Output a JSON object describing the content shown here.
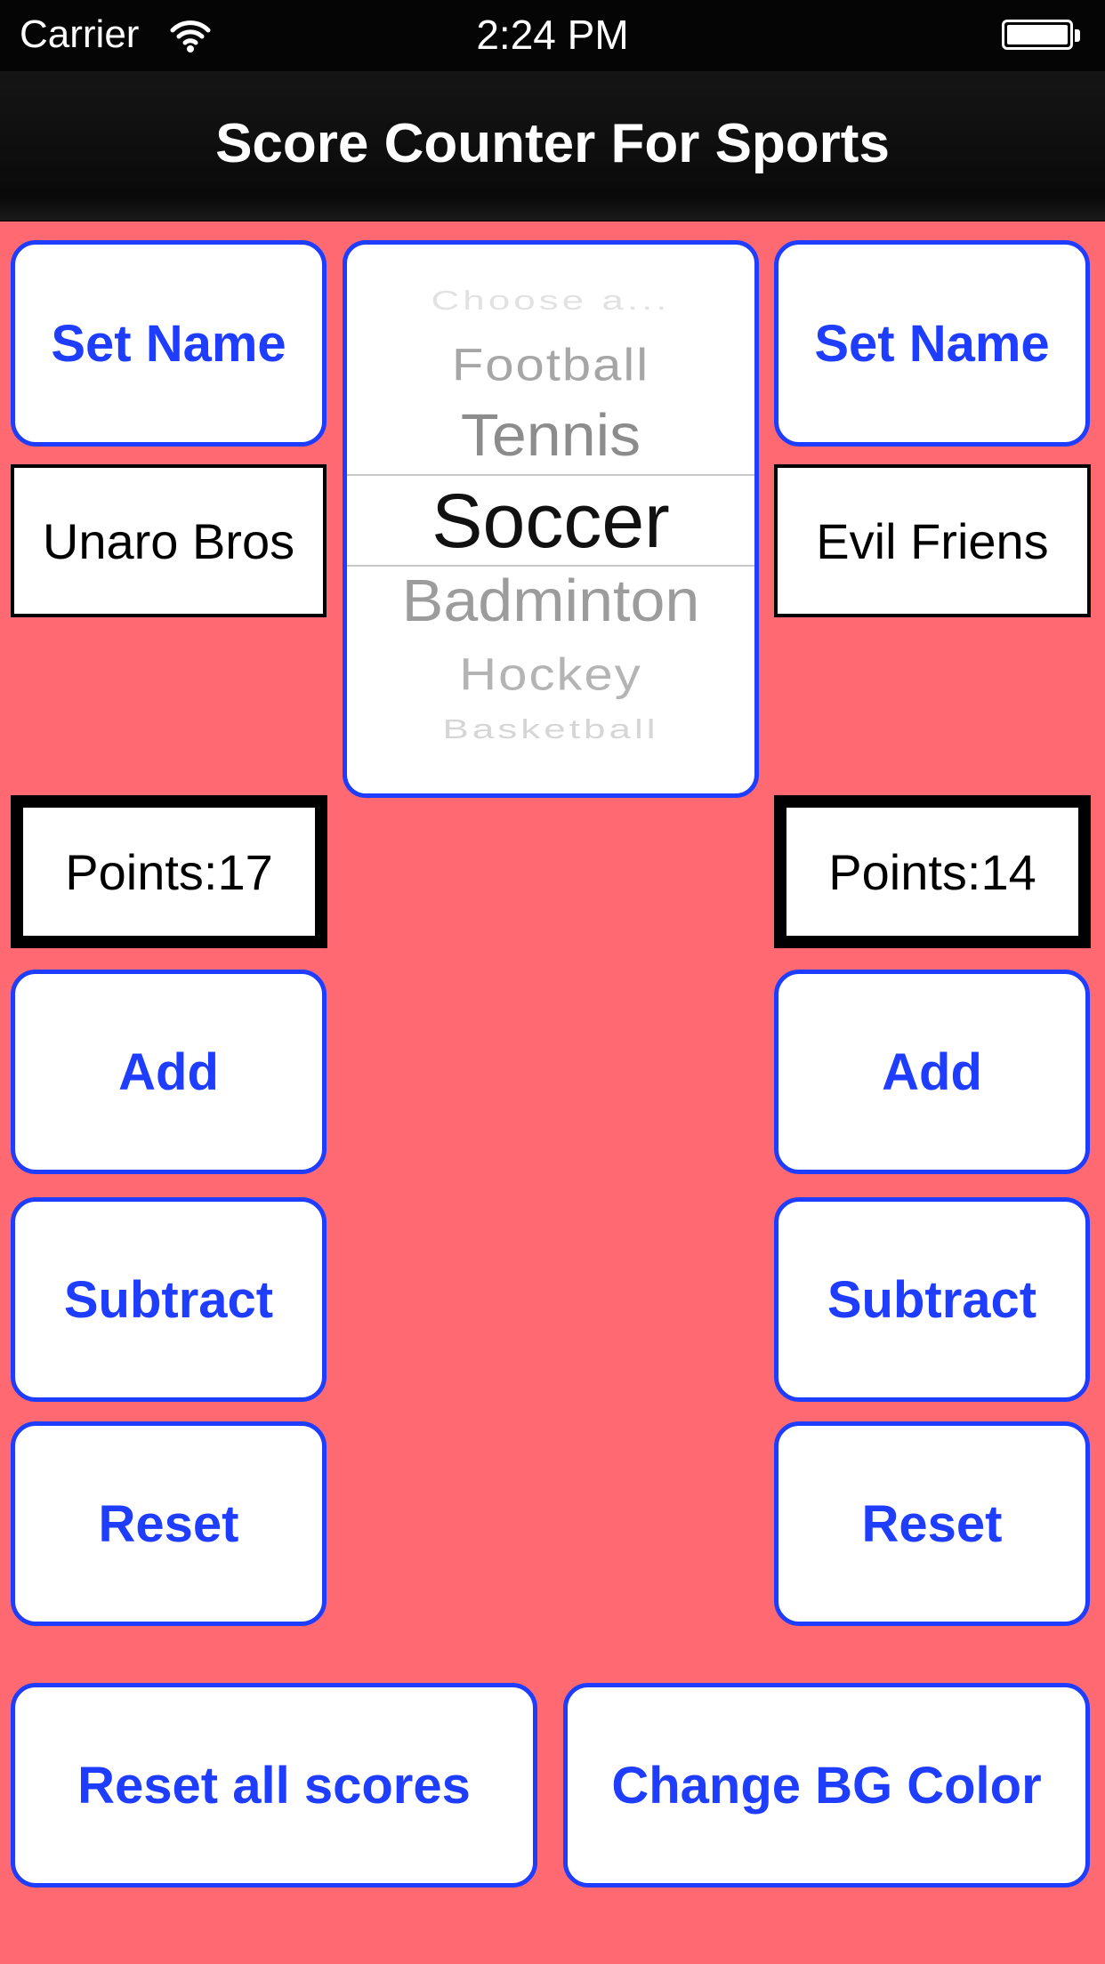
{
  "status_bar": {
    "carrier": "Carrier",
    "time": "2:24 PM"
  },
  "nav": {
    "title": "Score Counter For Sports"
  },
  "picker": {
    "items": [
      "Choose a...",
      "Football",
      "Tennis",
      "Soccer",
      "Badminton",
      "Hockey",
      "Basketball"
    ],
    "selected": "Soccer"
  },
  "team_left": {
    "set_name_label": "Set Name",
    "name": "Unaro Bros",
    "points": "Points:17",
    "add_label": "Add",
    "subtract_label": "Subtract",
    "reset_label": "Reset"
  },
  "team_right": {
    "set_name_label": "Set Name",
    "name": "Evil Friens",
    "points": "Points:14",
    "add_label": "Add",
    "subtract_label": "Subtract",
    "reset_label": "Reset"
  },
  "footer": {
    "reset_all_label": "Reset all scores",
    "change_bg_label": "Change BG Color"
  },
  "colors": {
    "background": "#ff6a72",
    "accent": "#1f3dff",
    "navbar": "#0a0a0a"
  }
}
